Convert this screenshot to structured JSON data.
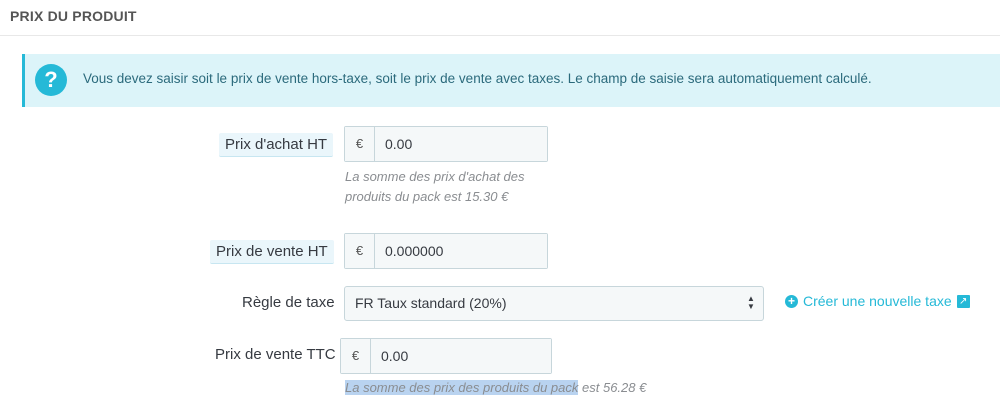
{
  "panel": {
    "title": "PRIX DU PRODUIT"
  },
  "alert": {
    "icon": "?",
    "text": "Vous devez saisir soit le prix de vente hors-taxe, soit le prix de vente avec taxes. Le champ de saisie sera automatiquement calculé."
  },
  "fields": {
    "purchase": {
      "label": "Prix d'achat HT",
      "currency": "€",
      "value": "0.00",
      "help_line1": "La somme des prix d'achat des",
      "help_line2": "produits du pack est 15.30 €"
    },
    "sale_ht": {
      "label": "Prix de vente HT",
      "currency": "€",
      "value": "0.000000"
    },
    "tax_rule": {
      "label": "Règle de taxe",
      "selected": "FR Taux standard (20%)",
      "create_link": "Créer une nouvelle taxe"
    },
    "sale_ttc": {
      "label": "Prix de vente TTC",
      "currency": "€",
      "value": "0.00",
      "help_highlighted": "La somme des prix des produits du pack",
      "help_rest": " est 56.28 €"
    }
  },
  "icons": {
    "alert": "question-circle-icon",
    "create": "plus-circle-icon",
    "external": "external-link-icon",
    "select": "chevron-up-down-icon"
  },
  "colors": {
    "accent": "#25b9d7",
    "alert_bg": "#dcf4f9",
    "highlight": "#b9d3f0"
  }
}
